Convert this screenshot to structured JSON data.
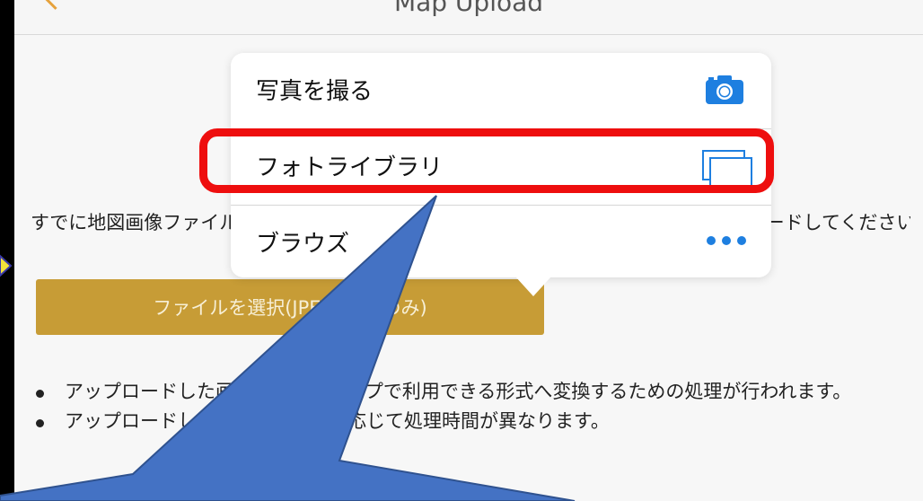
{
  "navbar": {
    "title": "Map Upload"
  },
  "description": "すでに地図画像ファイルをお持ちの方は、下記ボタンからファイルを選択してアップロードしてください。",
  "file_button": {
    "label": "ファイルを選択(JPEG/PNGのみ)"
  },
  "notes": [
    "アップロードした画像はStrolyマップで利用できる形式へ変換するための処理が行われます。",
    "アップロードした画像の大きさに応じて処理時間が異なります。"
  ],
  "popover": {
    "items": [
      {
        "label": "写真を撮る",
        "icon": "camera-icon"
      },
      {
        "label": "フォトライブラリ",
        "icon": "photo-library-icon"
      },
      {
        "label": "ブラウズ",
        "icon": "more-icon"
      }
    ]
  },
  "colors": {
    "accent": "#1e7fe0",
    "button": "#c79c36",
    "highlight": "#ee0e0e",
    "callout": "#4472c4"
  }
}
